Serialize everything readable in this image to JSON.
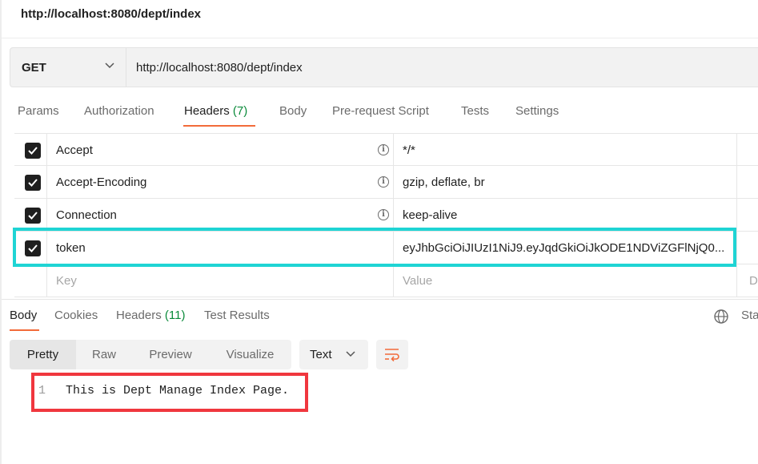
{
  "request_title": "http://localhost:8080/dept/index",
  "request": {
    "method": "GET",
    "url": "http://localhost:8080/dept/index"
  },
  "request_tabs": [
    {
      "label": "Params"
    },
    {
      "label": "Authorization"
    },
    {
      "label": "Headers",
      "count": "(7)"
    },
    {
      "label": "Body"
    },
    {
      "label": "Pre-request Script"
    },
    {
      "label": "Tests"
    },
    {
      "label": "Settings"
    }
  ],
  "headers": [
    {
      "key": "Accept",
      "value": "*/*"
    },
    {
      "key": "Accept-Encoding",
      "value": "gzip, deflate, br"
    },
    {
      "key": "Connection",
      "value": "keep-alive"
    },
    {
      "key": "token",
      "value": "eyJhbGciOiJIUzI1NiJ9.eyJqdGkiOiJkODE1NDViZGFlNjQ0..."
    }
  ],
  "headers_placeholder": {
    "key": "Key",
    "value": "Value",
    "extra": "D"
  },
  "response_tabs": [
    {
      "label": "Body"
    },
    {
      "label": "Cookies"
    },
    {
      "label": "Headers",
      "count": "(11)"
    },
    {
      "label": "Test Results"
    }
  ],
  "response_status_cut": "Sta",
  "view_modes": [
    "Pretty",
    "Raw",
    "Preview",
    "Visualize"
  ],
  "format": "Text",
  "response_body": {
    "line_number": "1",
    "text": "This is Dept Manage Index Page."
  },
  "colors": {
    "accent": "#f26b3a",
    "count_green": "#0a8a3a",
    "highlight_cyan": "#1fd4d4",
    "highlight_red": "#f0373e"
  },
  "icons": [
    "chevron-down-icon",
    "info-icon",
    "checkbox-checked-icon",
    "globe-icon",
    "wrap-lines-icon"
  ]
}
